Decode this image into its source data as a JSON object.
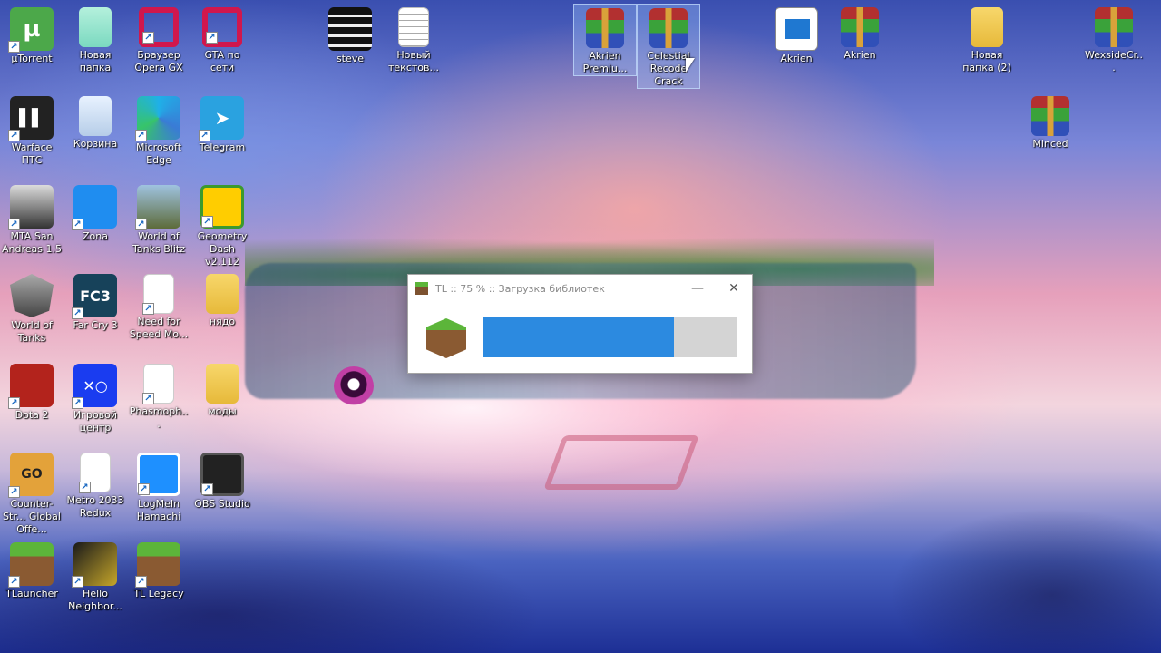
{
  "desktop": {
    "icons": [
      {
        "label": "µTorrent",
        "icon": "utorrent-icon"
      },
      {
        "label": "Новая папка",
        "icon": "folder-icon"
      },
      {
        "label": "Браузер Opera GX",
        "icon": "opera-gx-icon"
      },
      {
        "label": "GTA по сети",
        "icon": "opera-icon"
      },
      {
        "label": "steve",
        "icon": "steve-icon"
      },
      {
        "label": "Новый текстов...",
        "icon": "text-file-icon"
      },
      {
        "label": "Akrien Premiu...",
        "icon": "winrar-icon"
      },
      {
        "label": "Celestial Recode Crack",
        "icon": "winrar-icon"
      },
      {
        "label": "Akrien",
        "icon": "akrien-window-icon"
      },
      {
        "label": "Akrien",
        "icon": "winrar-icon"
      },
      {
        "label": "Новая папка (2)",
        "icon": "folder-icon"
      },
      {
        "label": "WexsideCr...",
        "icon": "winrar-icon"
      },
      {
        "label": "Warface ПТС",
        "icon": "warface-icon"
      },
      {
        "label": "Корзина",
        "icon": "recycle-bin-icon"
      },
      {
        "label": "Microsoft Edge",
        "icon": "edge-icon"
      },
      {
        "label": "Telegram",
        "icon": "telegram-icon"
      },
      {
        "label": "Minced",
        "icon": "winrar-icon"
      },
      {
        "label": "MTA San Andreas 1.5",
        "icon": "mta-icon"
      },
      {
        "label": "Zona",
        "icon": "zona-icon"
      },
      {
        "label": "World of Tanks Blitz",
        "icon": "wot-blitz-icon"
      },
      {
        "label": "Geometry Dash v2.112",
        "icon": "geometry-dash-icon"
      },
      {
        "label": "World of Tanks",
        "icon": "wot-icon"
      },
      {
        "label": "Far Cry 3",
        "icon": "far-cry-3-icon"
      },
      {
        "label": "Need for Speed Mo...",
        "icon": "file-icon"
      },
      {
        "label": "нядо",
        "icon": "folder-icon"
      },
      {
        "label": "Dota 2",
        "icon": "dota2-icon"
      },
      {
        "label": "Игровой центр",
        "icon": "game-center-icon"
      },
      {
        "label": "Phasmoph...",
        "icon": "file-icon"
      },
      {
        "label": "моды",
        "icon": "folder-icon"
      },
      {
        "label": "Counter-Str... Global Offe...",
        "icon": "csgo-icon"
      },
      {
        "label": "Metro 2033 Redux",
        "icon": "file-icon"
      },
      {
        "label": "LogMeIn Hamachi",
        "icon": "hamachi-icon"
      },
      {
        "label": "OBS Studio",
        "icon": "obs-icon"
      },
      {
        "label": "TLauncher",
        "icon": "tlauncher-icon"
      },
      {
        "label": "Hello Neighbor...",
        "icon": "hello-neighbor-icon"
      },
      {
        "label": "TL Legacy",
        "icon": "tl-legacy-icon"
      }
    ]
  },
  "popup": {
    "title": "TL :: 75 % :: Загрузка библиотек",
    "progress_percent": 75,
    "minimize_glyph": "—",
    "close_glyph": "✕"
  },
  "glyphs": {
    "fc3": "FC3",
    "game_center": "✕○",
    "csgo": "GO",
    "utorrent": "µ",
    "shortcut": "↗",
    "warface": "▌▌",
    "telegram": "➤"
  }
}
